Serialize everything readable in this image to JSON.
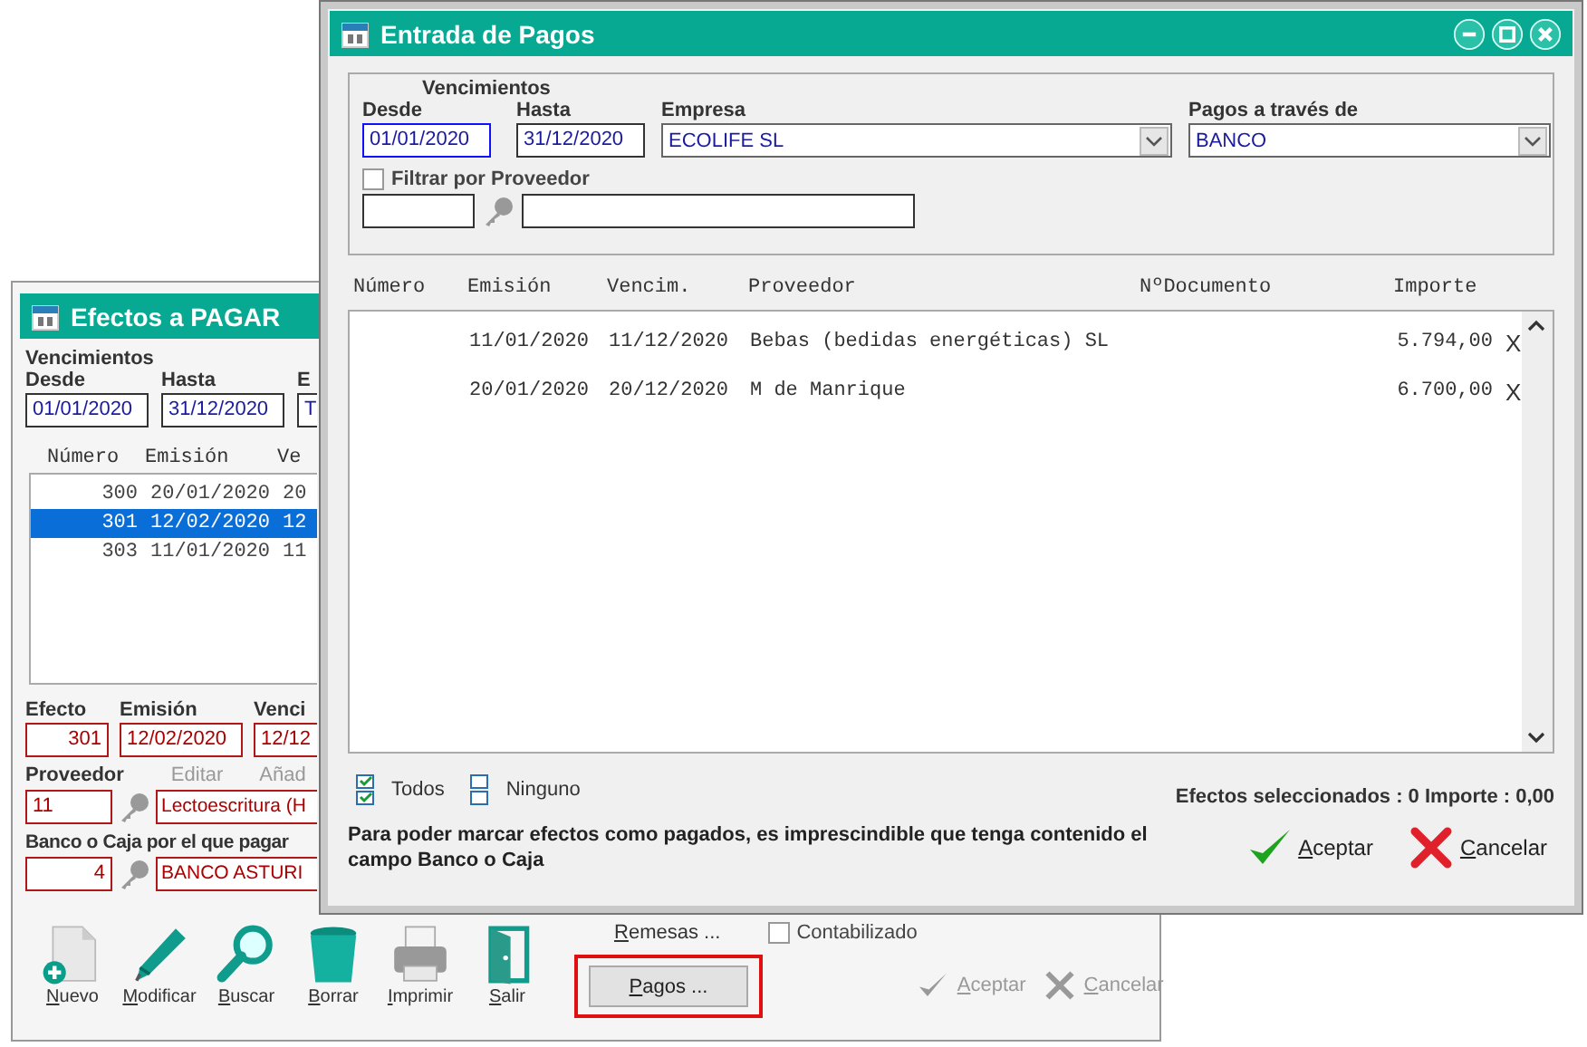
{
  "back_window": {
    "title": "Efectos a PAGAR",
    "vencimientos": {
      "label": "Vencimientos",
      "fields": [
        {
          "label": "Desde",
          "value": "01/01/2020"
        },
        {
          "label": "Hasta",
          "value": "31/12/2020"
        },
        {
          "label": "E",
          "value": "T"
        }
      ]
    },
    "list": {
      "columns": [
        "Número",
        "Emisión",
        "Ve"
      ],
      "rows": [
        {
          "cells": [
            "300",
            "20/01/2020",
            "20"
          ],
          "selected": false
        },
        {
          "cells": [
            "301",
            "12/02/2020",
            "12"
          ],
          "selected": true
        },
        {
          "cells": [
            "303",
            "11/01/2020",
            "11"
          ],
          "selected": false
        }
      ]
    },
    "efecto": [
      {
        "label": "Efecto",
        "value": "301"
      },
      {
        "label": "Emisión",
        "value": "12/02/2020"
      },
      {
        "label": "Venci",
        "value": "12/12"
      }
    ],
    "proveedor": {
      "label": "Proveedor",
      "links": [
        "Editar",
        "Añad"
      ],
      "code": "11",
      "name": "Lectoescritura (H"
    },
    "banco": {
      "label": "Banco o Caja por el que pagar",
      "code": "4",
      "name": "BANCO ASTURI"
    },
    "toolbar": [
      {
        "label": "Nuevo",
        "kind": "new"
      },
      {
        "label": "Modificar",
        "kind": "edit"
      },
      {
        "label": "Buscar",
        "kind": "search"
      },
      {
        "label": "Borrar",
        "kind": "delete"
      },
      {
        "label": "Imprimir",
        "kind": "print"
      },
      {
        "label": "Salir",
        "kind": "exit"
      }
    ],
    "remesas": "Remesas ...",
    "contabilizado": {
      "label": "Contabilizado",
      "checked": false
    },
    "pagos_button": {
      "label": "Pagos ...",
      "highlighted": true
    },
    "buttons": [
      {
        "label": "Aceptar",
        "kind": "accept",
        "disabled": true
      },
      {
        "label": "Cancelar",
        "kind": "cancel",
        "disabled": true
      }
    ]
  },
  "front_window": {
    "title": "Entrada de Pagos",
    "filters": {
      "group_label": "Vencimientos",
      "desde": {
        "label": "Desde",
        "value": "01/01/2020",
        "focused": true
      },
      "hasta": {
        "label": "Hasta",
        "value": "31/12/2020",
        "focused": false
      },
      "empresa": {
        "label": "Empresa",
        "value": "ECOLIFE SL"
      },
      "pagos_via": {
        "label": "Pagos a través de",
        "value": "BANCO"
      },
      "filtrar": {
        "label": "Filtrar por Proveedor",
        "checked": false
      }
    },
    "table": {
      "columns": [
        "Número",
        "Emisión",
        "Vencim.",
        "Proveedor",
        "NºDocumento",
        "Importe"
      ],
      "rows": [
        {
          "emision": "11/01/2020",
          "vencim": "11/12/2020",
          "proveedor": "Bebas (bedidas energéticas) SL",
          "importe": "5.794,00",
          "remove": "X"
        },
        {
          "emision": "20/01/2020",
          "vencim": "20/12/2020",
          "proveedor": "M de Manrique",
          "importe": "6.700,00",
          "remove": "X"
        }
      ]
    },
    "select_all": "Todos",
    "select_none": "Ninguno",
    "summary": "Efectos seleccionados : 0 Importe : 0,00",
    "note": "Para poder marcar efectos como pagados, es imprescindible que tenga contenido el campo Banco o Caja",
    "buttons": [
      {
        "label": "Aceptar",
        "kind": "accept",
        "disabled": false
      },
      {
        "label": "Cancelar",
        "kind": "cancel",
        "disabled": false
      }
    ]
  }
}
